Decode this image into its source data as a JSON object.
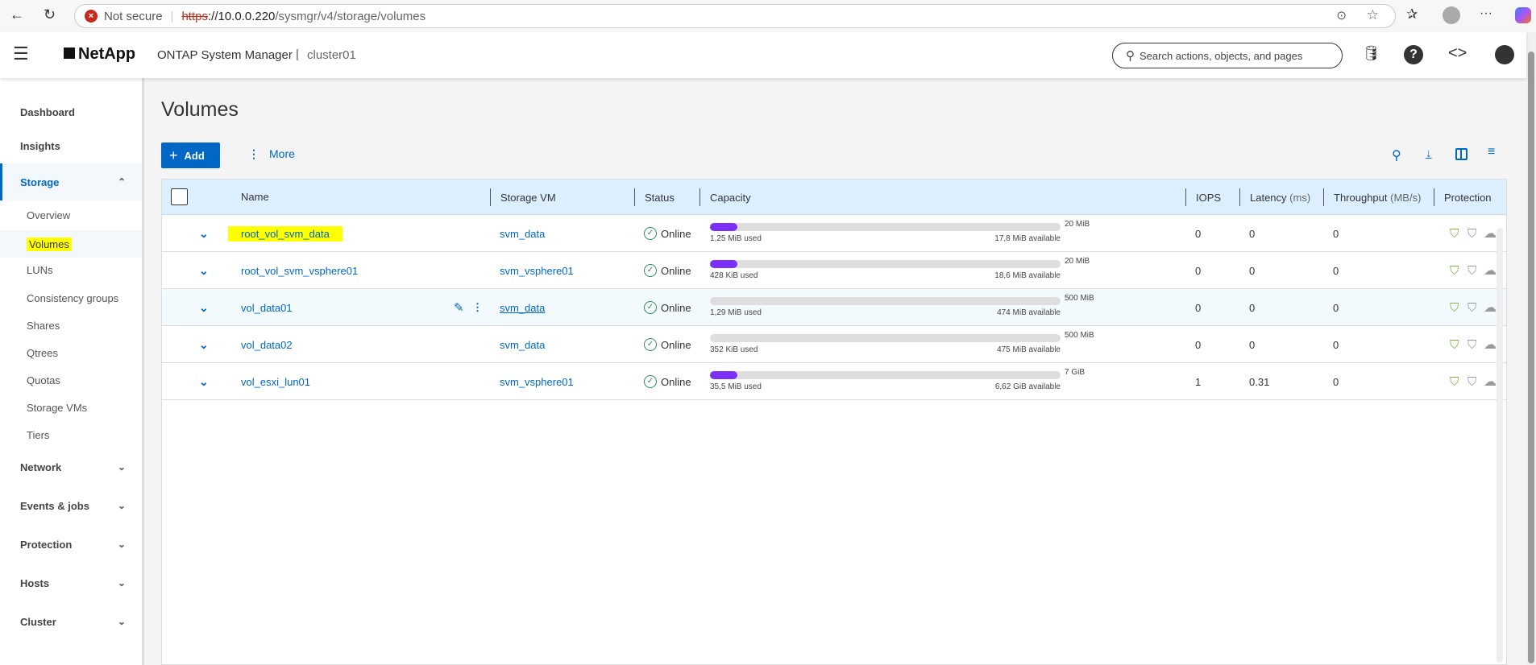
{
  "browser": {
    "not_secure": "Not secure",
    "url_scheme": "https",
    "url_host": "://10.0.0.220",
    "url_path": "/sysmgr/v4/storage/volumes"
  },
  "header": {
    "logo": "NetApp",
    "app_title": "ONTAP System Manager",
    "separator": "|",
    "cluster": "cluster01",
    "search_placeholder": "Search actions, objects, and pages"
  },
  "sidebar": {
    "dashboard": "Dashboard",
    "insights": "Insights",
    "storage": "Storage",
    "storage_items": [
      "Overview",
      "Volumes",
      "LUNs",
      "Consistency groups",
      "Shares",
      "Qtrees",
      "Quotas",
      "Storage VMs",
      "Tiers"
    ],
    "network": "Network",
    "events": "Events & jobs",
    "protection": "Protection",
    "hosts": "Hosts",
    "cluster": "Cluster"
  },
  "page": {
    "title": "Volumes",
    "add_label": "Add",
    "more_label": "More"
  },
  "table": {
    "columns": [
      "Name",
      "Storage VM",
      "Status",
      "Capacity",
      "IOPS",
      "Latency",
      "(ms)",
      "Throughput",
      "(MB/s)",
      "Protection"
    ],
    "rows": [
      {
        "name": "root_vol_svm_data",
        "svm": "svm_data",
        "status": "Online",
        "total": "20 MiB",
        "used": "1,25 MiB used",
        "available": "17,8 MiB available",
        "used_pct": 6.25,
        "iops": "0",
        "latency": "0",
        "throughput": "0"
      },
      {
        "name": "root_vol_svm_vsphere01",
        "svm": "svm_vsphere01",
        "status": "Online",
        "total": "20 MiB",
        "used": "428 KiB used",
        "available": "18,6 MiB available",
        "used_pct": 2.1,
        "iops": "0",
        "latency": "0",
        "throughput": "0"
      },
      {
        "name": "vol_data01",
        "svm": "svm_data",
        "status": "Online",
        "total": "500 MiB",
        "used": "1,29 MiB used",
        "available": "474 MiB available",
        "used_pct": 0.26,
        "iops": "0",
        "latency": "0",
        "throughput": "0"
      },
      {
        "name": "vol_data02",
        "svm": "svm_data",
        "status": "Online",
        "total": "500 MiB",
        "used": "352 KiB used",
        "available": "475 MiB available",
        "used_pct": 0.07,
        "iops": "0",
        "latency": "0",
        "throughput": "0"
      },
      {
        "name": "vol_esxi_lun01",
        "svm": "svm_vsphere01",
        "status": "Online",
        "total": "7 GiB",
        "used": "35,5 MiB used",
        "available": "6,62 GiB available",
        "used_pct": 0.5,
        "iops": "1",
        "latency": "0.31",
        "throughput": "0"
      }
    ]
  },
  "colors": {
    "accent": "#0067c5",
    "used_fill": "#7b2ff7",
    "highlight": "#ffff00",
    "online": "#2e8b57"
  }
}
